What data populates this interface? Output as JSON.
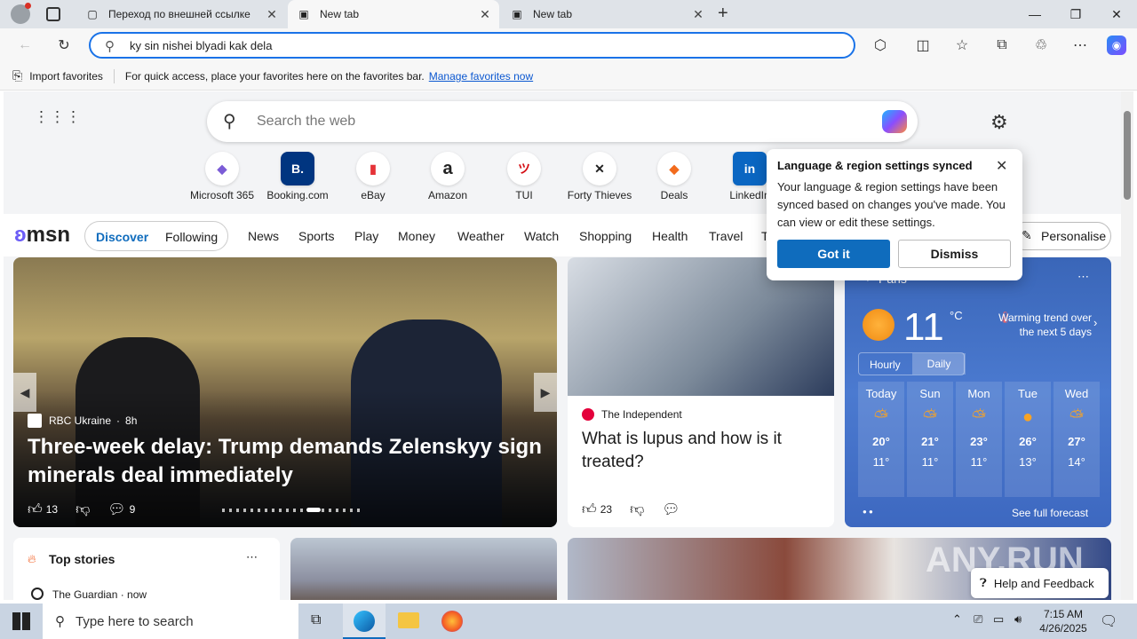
{
  "tabs": [
    {
      "title": "Переход по внешней ссылке"
    },
    {
      "title": "New tab"
    },
    {
      "title": "New tab"
    }
  ],
  "address": {
    "value": "ky sin nishei blyadi kak dela"
  },
  "favbar": {
    "import": "Import favorites",
    "hint": "For quick access, place your favorites here on the favorites bar.",
    "manage": "Manage favorites now"
  },
  "ntp": {
    "search_placeholder": "Search the web",
    "quicklinks": [
      {
        "label": "Microsoft 365",
        "glyph": "◆",
        "color": "#7b5cd6"
      },
      {
        "label": "Booking.com",
        "glyph": "B.",
        "color": "#003580"
      },
      {
        "label": "eBay",
        "glyph": "▮",
        "color": "#e53238"
      },
      {
        "label": "Amazon",
        "glyph": "a",
        "color": "#111111"
      },
      {
        "label": "TUI",
        "glyph": "ツ",
        "color": "#d40e14"
      },
      {
        "label": "Forty Thieves",
        "glyph": "✕",
        "color": "#111111"
      },
      {
        "label": "Deals",
        "glyph": "◆",
        "color": "#f26b1d"
      },
      {
        "label": "LinkedIn",
        "glyph": "in",
        "color": "#0a66c2"
      }
    ],
    "brand": "msn",
    "seg": [
      "Discover",
      "Following"
    ],
    "nav": [
      "News",
      "Sports",
      "Play",
      "Money",
      "Weather",
      "Watch",
      "Shopping",
      "Health",
      "Travel",
      "T"
    ],
    "personalise": "Personalise"
  },
  "hero": {
    "source": "RBC Ukraine",
    "age": "8h",
    "headline": "Three-week delay: Trump demands Zelenskyy sign minerals deal immediately",
    "likes": "13",
    "comments": "9"
  },
  "story2": {
    "source": "The Independent",
    "headline": "What is lupus and how is it treated?",
    "likes": "23"
  },
  "weather": {
    "city": "Paris",
    "temp": "11",
    "unit": "°C",
    "trend": "Warming trend over the next 5 days",
    "tabs": [
      "Hourly",
      "Daily"
    ],
    "days": [
      {
        "d": "Today",
        "hi": "20°",
        "lo": "11°"
      },
      {
        "d": "Sun",
        "hi": "21°",
        "lo": "11°"
      },
      {
        "d": "Mon",
        "hi": "23°",
        "lo": "11°"
      },
      {
        "d": "Tue",
        "hi": "26°",
        "lo": "13°"
      },
      {
        "d": "Wed",
        "hi": "27°",
        "lo": "14°"
      }
    ],
    "forecast": "See full forecast"
  },
  "topstories": {
    "title": "Top stories",
    "source": "The Guardian · now"
  },
  "popup": {
    "title": "Language & region settings synced",
    "body": "Your language & region settings have been synced based on changes you've made. You can view or edit these settings.",
    "ok": "Got it",
    "dismiss": "Dismiss"
  },
  "feedback": "Help and Feedback",
  "watermark": "ANY.RUN",
  "taskbar": {
    "search": "Type here to search",
    "time": "7:15 AM",
    "date": "4/26/2025"
  }
}
